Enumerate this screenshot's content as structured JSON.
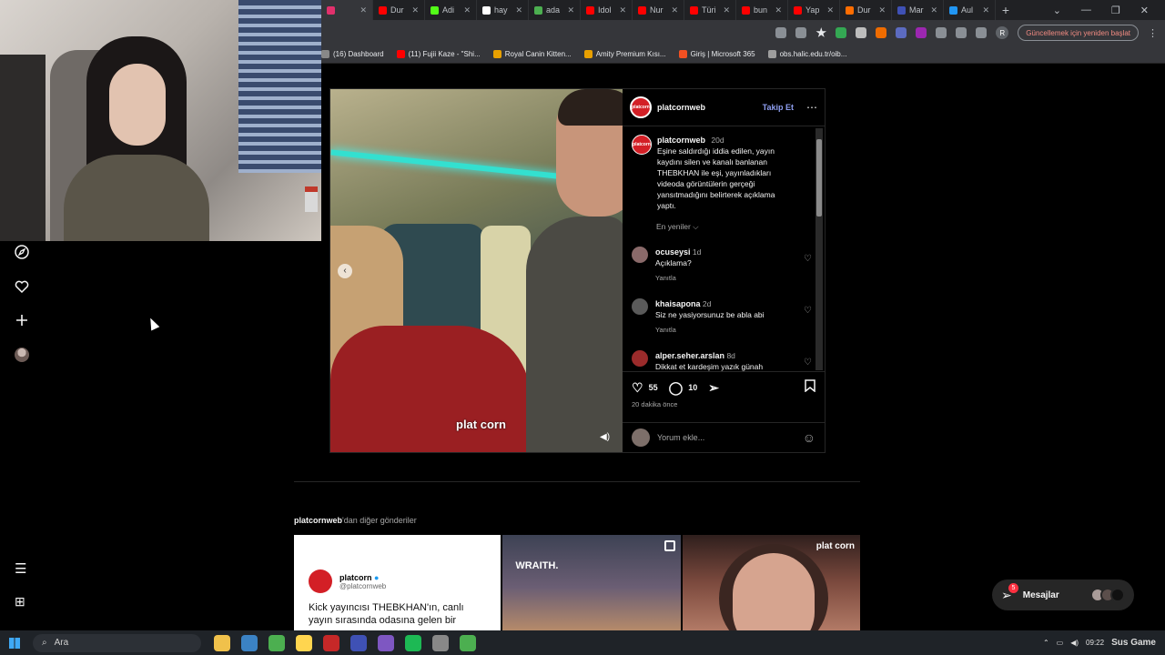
{
  "browser": {
    "tabs": [
      {
        "label": "",
        "color": "#e1306c",
        "active": true
      },
      {
        "label": "Dur",
        "color": "#ff0000"
      },
      {
        "label": "Adi",
        "color": "#53fc18"
      },
      {
        "label": "hay",
        "color": "#ffffff"
      },
      {
        "label": "ada",
        "color": "#4caf50"
      },
      {
        "label": "Idol",
        "color": "#ff0000"
      },
      {
        "label": "Nur",
        "color": "#ff0000"
      },
      {
        "label": "Türi",
        "color": "#ff0000"
      },
      {
        "label": "bun",
        "color": "#ff0000"
      },
      {
        "label": "Yap",
        "color": "#ff0000"
      },
      {
        "label": "Dur",
        "color": "#ff6d00"
      },
      {
        "label": "Mar",
        "color": "#3f51b5"
      },
      {
        "label": "Aul",
        "color": "#2196f3"
      }
    ],
    "new_tab": "+",
    "window_controls": [
      "⌄",
      "—",
      "❐",
      "✕"
    ],
    "update_button": "Güncellemek için yeniden başlat",
    "profile_initial": "R",
    "bookmarks": [
      {
        "label": "(16) Dashboard",
        "color": "#888888"
      },
      {
        "label": "(11) Fujii Kaze - \"Shi...",
        "color": "#ff0000"
      },
      {
        "label": "Royal Canin Kitten...",
        "color": "#e8a000"
      },
      {
        "label": "Amity Premium Kısı...",
        "color": "#e8a000"
      },
      {
        "label": "Giriş | Microsoft 365",
        "color": "#f25022"
      },
      {
        "label": "obs.halic.edu.tr/oib...",
        "color": "#9e9e9e"
      }
    ]
  },
  "post": {
    "author": "platcornweb",
    "follow_label": "Takip Et",
    "more_icon": "⋯",
    "avatar_text": "platcorn",
    "caption_age": "20d",
    "caption": "Eşine saldırdığı iddia edilen, yayın kaydını silen ve kanalı banlanan THEBKHAN ile eşi, yayınladıkları videoda görüntülerin gerçeği yansıtmadığını belirterek açıklama yaptı.",
    "sort_label": "En yeniler ⌵",
    "media_logo": "plat corn",
    "comments": [
      {
        "user": "ocuseysi",
        "age": "1d",
        "text": "Açıklama?",
        "reply": "Yanıtla",
        "avatar": "#8a6a6a"
      },
      {
        "user": "khaisapona",
        "age": "2d",
        "text": "Siz ne yasiyorsunuz be abla abi",
        "reply": "Yanıtla",
        "avatar": "#5a5a5a"
      },
      {
        "user": "alper.seher.arslan",
        "age": "8d",
        "text": "Dikkat et kardeşim yazık günah",
        "reply": "Yanıtla",
        "avatar": "#9b2b2b"
      }
    ],
    "likes": "55",
    "comment_count": "10",
    "time_ago": "20 dakika önce",
    "comment_placeholder": "Yorum ekle..."
  },
  "more_posts": {
    "title_user": "platcornweb",
    "title_rest": "'dan diğer gönderiler",
    "tweet": {
      "name": "platcorn",
      "handle": "@platcornweb",
      "text": "Kick yayıncısı THEBKHAN'ın, canlı yayın sırasında odasına gelen bir"
    },
    "tile2_label": "WRAITH.",
    "tile3_logo": "plat corn"
  },
  "messages": {
    "label": "Mesajlar",
    "badge": "5"
  },
  "taskbar": {
    "search_placeholder": "Ara",
    "time": "09:22",
    "watermark": "Sus Game",
    "apps": [
      "#f0c14b",
      "#3b82c4",
      "#4caf50",
      "#ffd54f",
      "#c62828",
      "#3f51b5",
      "#7e57c2",
      "#1db954",
      "#888888",
      "#4caf50"
    ]
  }
}
